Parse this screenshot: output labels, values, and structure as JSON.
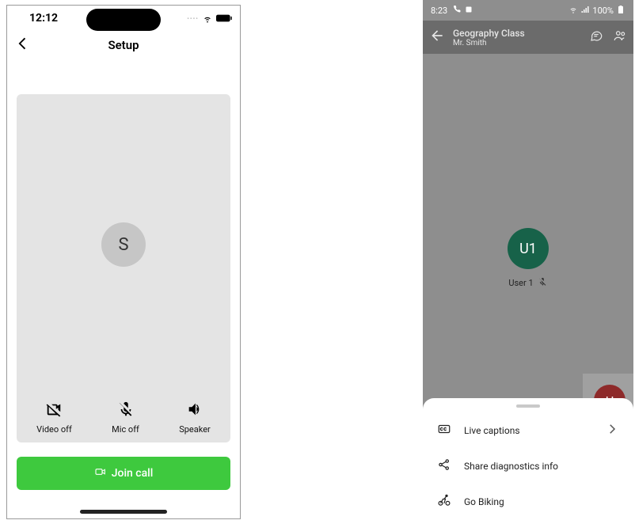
{
  "ios": {
    "status": {
      "time": "12:12"
    },
    "nav": {
      "title": "Setup"
    },
    "avatar_letter": "S",
    "controls": {
      "video": "Video off",
      "mic": "Mic off",
      "speaker": "Speaker"
    },
    "join_label": "Join call"
  },
  "android": {
    "status": {
      "time": "8:23",
      "battery": "100%"
    },
    "header": {
      "title": "Geography Class",
      "subtitle": "Mr. Smith"
    },
    "participant": {
      "avatar": "U1",
      "name": "User 1"
    },
    "floating_avatar": "U",
    "sheet": {
      "items": [
        {
          "icon": "cc",
          "label": "Live captions",
          "chevron": true
        },
        {
          "icon": "share",
          "label": "Share diagnostics info",
          "chevron": false
        },
        {
          "icon": "bike",
          "label": "Go Biking",
          "chevron": false
        }
      ]
    }
  }
}
